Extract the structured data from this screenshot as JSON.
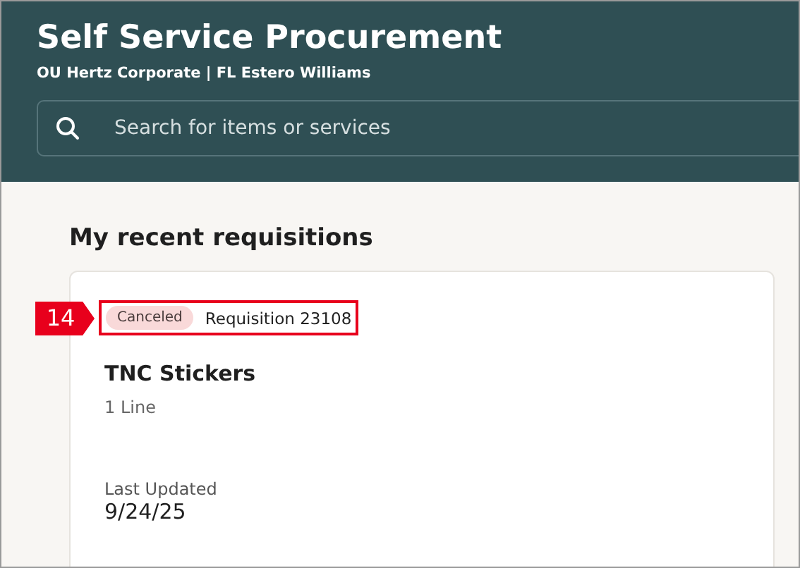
{
  "header": {
    "title": "Self Service Procurement",
    "subtitle": "OU Hertz Corporate | FL Estero Williams",
    "search": {
      "placeholder": "Search for items or services"
    }
  },
  "section": {
    "title": "My recent requisitions"
  },
  "requisitions": [
    {
      "status": {
        "label": "Canceled",
        "kind": "canceled"
      },
      "number": "Requisition 23108",
      "name": "TNC Stickers",
      "lines": "1 Line",
      "updated_label": "Last Updated",
      "updated": "9/24/25",
      "callout": "14"
    }
  ]
}
